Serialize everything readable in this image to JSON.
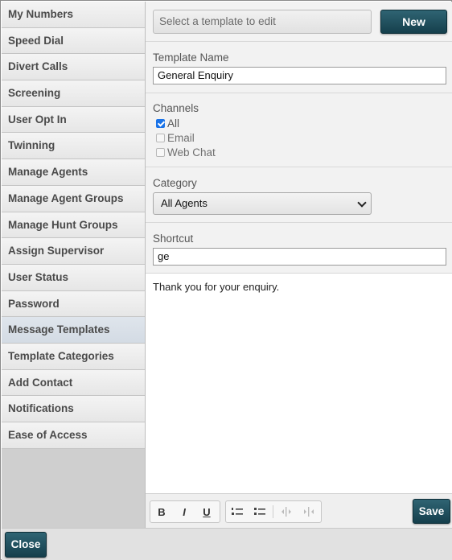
{
  "sidebar": {
    "items": [
      {
        "label": "My Numbers"
      },
      {
        "label": "Speed Dial"
      },
      {
        "label": "Divert Calls"
      },
      {
        "label": "Screening"
      },
      {
        "label": "User Opt In"
      },
      {
        "label": "Twinning"
      },
      {
        "label": "Manage Agents"
      },
      {
        "label": "Manage Agent Groups"
      },
      {
        "label": "Manage Hunt Groups"
      },
      {
        "label": "Assign Supervisor"
      },
      {
        "label": "User Status"
      },
      {
        "label": "Password"
      },
      {
        "label": "Message Templates"
      },
      {
        "label": "Template Categories"
      },
      {
        "label": "Add Contact"
      },
      {
        "label": "Notifications"
      },
      {
        "label": "Ease of Access"
      }
    ],
    "active_index": 12
  },
  "template_select": {
    "placeholder": "Select a template to edit"
  },
  "buttons": {
    "new": "New",
    "save": "Save",
    "close": "Close"
  },
  "template_name": {
    "label": "Template Name",
    "value": "General Enquiry"
  },
  "channels": {
    "label": "Channels",
    "options": [
      {
        "label": "All",
        "checked": true
      },
      {
        "label": "Email",
        "checked": false
      },
      {
        "label": "Web Chat",
        "checked": false
      }
    ]
  },
  "category": {
    "label": "Category",
    "selected": "All Agents"
  },
  "shortcut": {
    "label": "Shortcut",
    "value": "ge"
  },
  "editor": {
    "content": "Thank you for your enquiry."
  },
  "toolbar": {
    "bold": "B",
    "italic": "I",
    "underline": "U"
  },
  "colors": {
    "accent": "#1f4f5e",
    "check": "#1a73e8"
  }
}
